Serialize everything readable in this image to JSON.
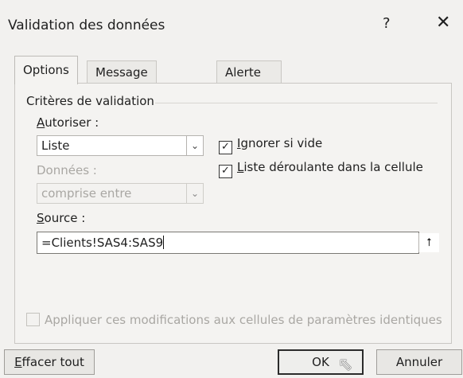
{
  "window": {
    "title": "Validation des données",
    "help_label": "?",
    "close_label": "✕"
  },
  "tabs": [
    {
      "label": "Options",
      "active": true
    },
    {
      "label": "Message de saisie",
      "active": false
    },
    {
      "label": "Alerte d'erreur",
      "active": false
    }
  ],
  "criteria": {
    "section_title": "Critères de validation",
    "allow": {
      "label_underlined": "A",
      "label_rest": "utoriser :",
      "value": "Liste"
    },
    "data": {
      "label": "Données :",
      "value": "comprise entre",
      "disabled": true
    },
    "ignore_blank": {
      "label_underlined": "I",
      "label_rest": "gnorer si vide",
      "checked": true
    },
    "in_cell_dropdown": {
      "label_underlined": "L",
      "label_rest": "iste déroulante dans la cellule",
      "checked": true
    },
    "source": {
      "label_underlined": "S",
      "label_rest": "ource :",
      "value": "=Clients!SAS4:SAS9"
    }
  },
  "apply_all": {
    "label": "Appliquer ces modifications aux cellules de paramètres identiques",
    "checked": false,
    "disabled": true
  },
  "buttons": {
    "clear_underlined": "E",
    "clear_rest": "ffacer tout",
    "ok": "OK",
    "cancel": "Annuler"
  },
  "icons": {
    "dropdown": "chevron-down-icon",
    "collapse": "collapse-dialog-icon",
    "check": "checkmark-icon",
    "pointer": "mouse-pointer-icon"
  }
}
